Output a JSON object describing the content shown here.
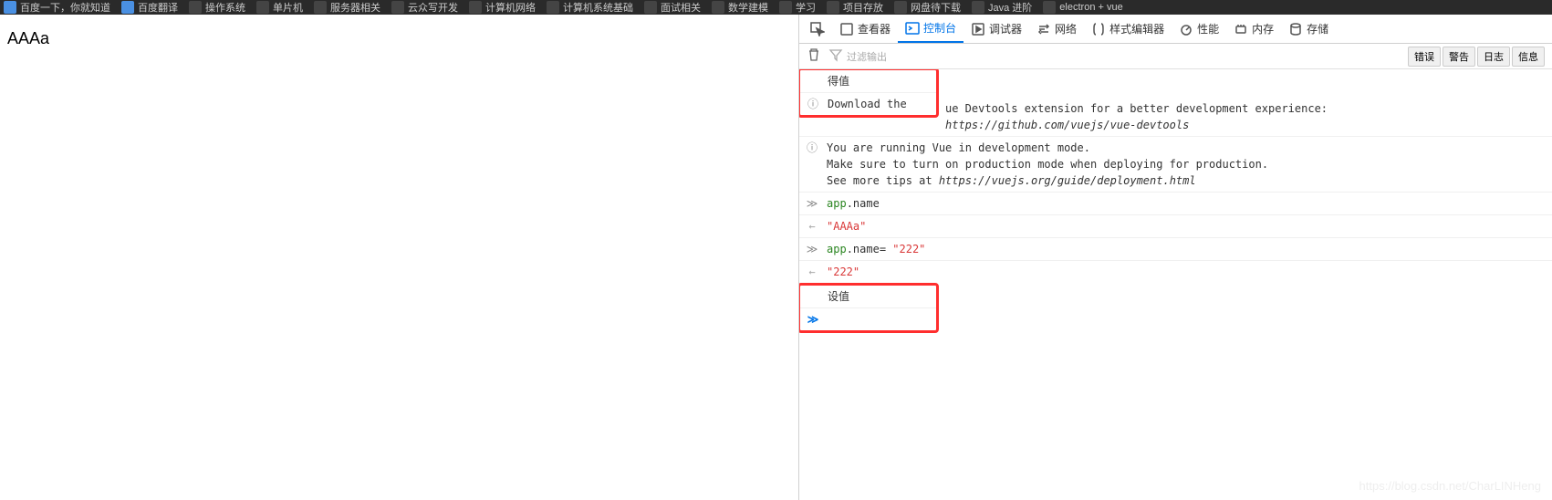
{
  "bookmarks": [
    {
      "label": "百度一下，你就知道",
      "iconClass": "blue"
    },
    {
      "label": "百度翻译",
      "iconClass": "blue"
    },
    {
      "label": "操作系统",
      "iconClass": ""
    },
    {
      "label": "单片机",
      "iconClass": ""
    },
    {
      "label": "服务器相关",
      "iconClass": ""
    },
    {
      "label": "云众写开发",
      "iconClass": ""
    },
    {
      "label": "计算机网络",
      "iconClass": ""
    },
    {
      "label": "计算机系统基础",
      "iconClass": ""
    },
    {
      "label": "面试相关",
      "iconClass": ""
    },
    {
      "label": "数学建模",
      "iconClass": ""
    },
    {
      "label": "学习",
      "iconClass": ""
    },
    {
      "label": "项目存放",
      "iconClass": ""
    },
    {
      "label": "网盘待下载",
      "iconClass": ""
    },
    {
      "label": "Java 进阶",
      "iconClass": ""
    },
    {
      "label": "electron + vue",
      "iconClass": ""
    }
  ],
  "page": {
    "content": "AAAa"
  },
  "devtools": {
    "tabs": {
      "inspector": "查看器",
      "console": "控制台",
      "debugger": "调试器",
      "network": "网络",
      "styleeditor": "样式编辑器",
      "performance": "性能",
      "memory": "内存",
      "storage": "存储"
    },
    "toolbar": {
      "filter_placeholder": "过滤输出",
      "filters": {
        "errors": "错误",
        "warnings": "警告",
        "logs": "日志",
        "info": "信息"
      }
    },
    "messages": {
      "m1": "得值",
      "m2a": "Download the ",
      "m2b": "ue Devtools extension for a better development experience:",
      "m2c": "https://github.com/vuejs/vue-devtools",
      "m3a": "You are running Vue in development mode.",
      "m3b": "Make sure to turn on production mode when deploying for production.",
      "m3c": "See more tips at ",
      "m3d": "https://vuejs.org/guide/deployment.html",
      "m4_obj": "app",
      "m4_prop": ".name",
      "m5": "\"AAAa\"",
      "m6_obj": "app",
      "m6_prop": ".name",
      "m6_eq": "=  ",
      "m6_val": "\"222\"",
      "m7": "\"222\"",
      "m8": "设值"
    }
  },
  "watermark": "https://blog.csdn.net/CharLINHeng"
}
